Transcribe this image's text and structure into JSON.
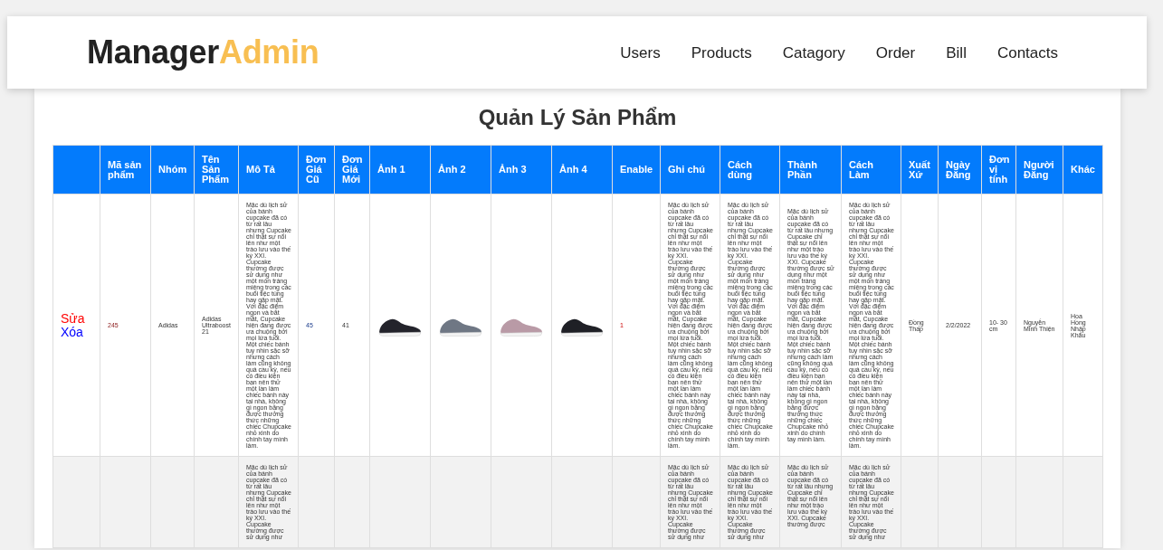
{
  "header": {
    "logo": {
      "primary": "Manager",
      "accent": "Admin"
    },
    "nav": [
      "Users",
      "Products",
      "Catagory",
      "Order",
      "Bill",
      "Contacts"
    ]
  },
  "page_title": "Quản Lý Sản Phẩm",
  "table": {
    "columns": [
      "Mã sản phẩm",
      "Nhóm",
      "Tên Sản Phẩm",
      "Mô Tả",
      "Đơn Giá Cũ",
      "Đơn Giá Mới",
      "Ảnh 1",
      "Ảnh 2",
      "Ảnh 3",
      "Ảnh 4",
      "Enable",
      "Ghi chú",
      "Cách dùng",
      "Thành Phần",
      "Cách Làm",
      "Xuất Xứ",
      "Ngày Đăng",
      "Đơn vị tính",
      "Người Đăng",
      "Khác"
    ],
    "rows": [
      {
        "actions": [
          {
            "kind": "edit",
            "label": "Sửa"
          },
          {
            "kind": "delete",
            "label": "Xóa"
          }
        ],
        "cells": [
          {
            "kind": "text",
            "text": "245"
          },
          {
            "kind": "text",
            "text": "Adidas"
          },
          {
            "kind": "text",
            "text": "Adidas Ultraboost 21"
          },
          {
            "kind": "long",
            "text": "Mặc dù lịch sử của bánh cupcake đã có từ rất lâu nhưng Cupcake chỉ thật sự nổi lên như một trào lưu vào thế kỷ XXI. Cupcake thường được sử dụng như một món tráng miệng trong các buổi tiệc tùng hay gặp mặt. Với đặc điểm ngon và bắt mắt, Cupcake hiện đang được ưa chuộng bởi mọi lứa tuổi. Một chiếc bánh tuy nhìn sặc sỡ nhưng cách làm cũng không quá cầu kỳ, nếu có điều kiện bạn nên thử một lần làm chiếc bánh này tại nhà, không gì ngon bằng được thưởng thức những chiếc Chupcake nhỏ xinh do chính tay mình làm."
          },
          {
            "kind": "text",
            "text": "45"
          },
          {
            "kind": "text",
            "text": "41"
          },
          {
            "kind": "image",
            "color": "#23232b"
          },
          {
            "kind": "image",
            "color": "#6f7784"
          },
          {
            "kind": "image",
            "color": "#b99aa6"
          },
          {
            "kind": "image",
            "color": "#1f2026"
          },
          {
            "kind": "text",
            "text": "1"
          },
          {
            "kind": "long",
            "text": "Mặc dù lịch sử của bánh cupcake đã có từ rất lâu nhưng Cupcake chỉ thật sự nổi lên như một trào lưu vào thế kỷ XXI. Cupcake thường được sử dụng như một món tráng miệng trong các buổi tiệc tùng hay gặp mặt. Với đặc điểm ngon và bắt mắt, Cupcake hiện đang được ưa chuộng bởi mọi lứa tuổi. Một chiếc bánh tuy nhìn sặc sỡ nhưng cách làm cũng không quá cầu kỳ, nếu có điều kiện bạn nên thử một lần làm chiếc bánh này tại nhà, không gì ngon bằng được thưởng thức những chiếc Chupcake nhỏ xinh do chính tay mình làm."
          },
          {
            "kind": "long",
            "text": "Mặc dù lịch sử của bánh cupcake đã có từ rất lâu nhưng Cupcake chỉ thật sự nổi lên như một trào lưu vào thế kỷ XXI. Cupcake thường được sử dụng như một món tráng miệng trong các buổi tiệc tùng hay gặp mặt. Với đặc điểm ngon và bắt mắt, Cupcake hiện đang được ưa chuộng bởi mọi lứa tuổi. Một chiếc bánh tuy nhìn sặc sỡ nhưng cách làm cũng không quá cầu kỳ, nếu có điều kiện bạn nên thử một lần làm chiếc bánh này tại nhà, không gì ngon bằng được thưởng thức những chiếc Chupcake nhỏ xinh do chính tay mình làm."
          },
          {
            "kind": "long",
            "text": "Mặc dù lịch sử của bánh cupcake đã có từ rất lâu nhưng Cupcake chỉ thật sự nổi lên như một trào lưu vào thế kỷ XXI. Cupcake thường được sử dụng như một món tráng miệng trong các buổi tiệc tùng hay gặp mặt. Với đặc điểm ngon và bắt mắt, Cupcake hiện đang được ưa chuộng bởi mọi lứa tuổi. Một chiếc bánh tuy nhìn sặc sỡ nhưng cách làm cũng không quá cầu kỳ, nếu có điều kiện bạn nên thử một lần làm chiếc bánh này tại nhà, không gì ngon bằng được thưởng thức những chiếc Chupcake nhỏ xinh do chính tay mình làm."
          },
          {
            "kind": "long",
            "text": "Mặc dù lịch sử của bánh cupcake đã có từ rất lâu nhưng Cupcake chỉ thật sự nổi lên như một trào lưu vào thế kỷ XXI. Cupcake thường được sử dụng như một món tráng miệng trong các buổi tiệc tùng hay gặp mặt. Với đặc điểm ngon và bắt mắt, Cupcake hiện đang được ưa chuộng bởi mọi lứa tuổi. Một chiếc bánh tuy nhìn sặc sỡ nhưng cách làm cũng không quá cầu kỳ, nếu có điều kiện bạn nên thử một lần làm chiếc bánh này tại nhà, không gì ngon bằng được thưởng thức những chiếc Chupcake nhỏ xinh do chính tay mình làm."
          },
          {
            "kind": "text",
            "text": "Đồng Thấp"
          },
          {
            "kind": "text",
            "text": "2/2/2022"
          },
          {
            "kind": "text",
            "text": "10- 30 cm"
          },
          {
            "kind": "text",
            "text": "Nguyễn Minh Thiện"
          },
          {
            "kind": "text",
            "text": "Hoa Hồng Nhập Khẩu"
          }
        ]
      },
      {
        "cells": [
          {
            "kind": "blank"
          },
          {
            "kind": "blank"
          },
          {
            "kind": "blank"
          },
          {
            "kind": "long",
            "text": "Mặc dù lịch sử của bánh cupcake đã có từ rất lâu nhưng Cupcake chỉ thật sự nổi lên như một trào lưu vào thế kỷ XXI. Cupcake thường được sử dụng như"
          },
          {
            "kind": "blank"
          },
          {
            "kind": "blank"
          },
          {
            "kind": "blank"
          },
          {
            "kind": "blank"
          },
          {
            "kind": "blank"
          },
          {
            "kind": "blank"
          },
          {
            "kind": "blank"
          },
          {
            "kind": "long",
            "text": "Mặc dù lịch sử của bánh cupcake đã có từ rất lâu nhưng Cupcake chỉ thật sự nổi lên như một trào lưu vào thế kỷ XXI. Cupcake thường được sử dụng như"
          },
          {
            "kind": "long",
            "text": "Mặc dù lịch sử của bánh cupcake đã có từ rất lâu nhưng Cupcake chỉ thật sự nổi lên như một trào lưu vào thế kỷ XXI. Cupcake thường được sử dụng như"
          },
          {
            "kind": "long",
            "text": "Mặc dù lịch sử của bánh cupcake đã có từ rất lâu nhưng Cupcake chỉ thật sự nổi lên như một trào lưu vào thế kỷ XXI. Cupcake thường được"
          },
          {
            "kind": "long",
            "text": "Mặc dù lịch sử của bánh cupcake đã có từ rất lâu nhưng Cupcake chỉ thật sự nổi lên như một trào lưu vào thế kỷ XXI. Cupcake thường được sử dụng như"
          },
          {
            "kind": "blank"
          },
          {
            "kind": "blank"
          },
          {
            "kind": "blank"
          },
          {
            "kind": "blank"
          },
          {
            "kind": "blank"
          }
        ]
      }
    ]
  }
}
